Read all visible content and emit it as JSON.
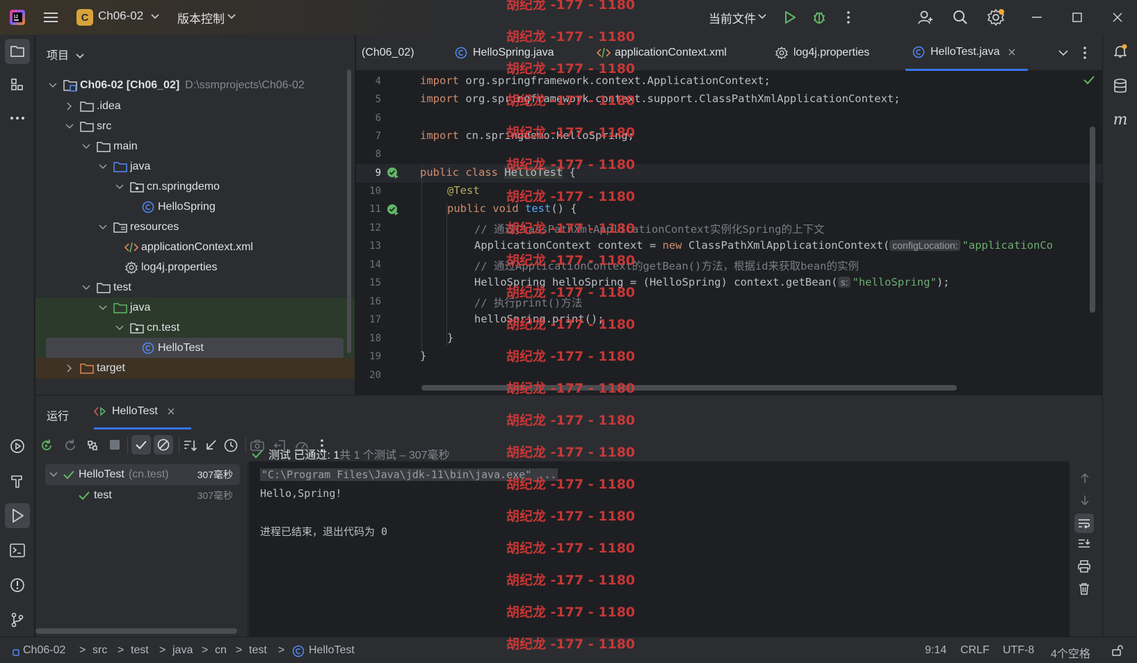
{
  "titlebar": {
    "project_badge": "C",
    "project_name": "Ch06-02",
    "vcs_menu": "版本控制",
    "run_config": "当前文件"
  },
  "project_panel": {
    "header": "项目",
    "tree": [
      {
        "label": "Ch06-02 [Ch06_02]",
        "path": "D:\\ssmprojects\\Ch06-02"
      },
      {
        "label": ".idea"
      },
      {
        "label": "src"
      },
      {
        "label": "main"
      },
      {
        "label": "java"
      },
      {
        "label": "cn.springdemo"
      },
      {
        "label": "HelloSpring"
      },
      {
        "label": "resources"
      },
      {
        "label": "applicationContext.xml"
      },
      {
        "label": "log4j.properties"
      },
      {
        "label": "test"
      },
      {
        "label": "java"
      },
      {
        "label": "cn.test"
      },
      {
        "label": "HelloTest"
      },
      {
        "label": "target"
      }
    ]
  },
  "tabs": [
    {
      "label": "(Ch06_02)"
    },
    {
      "label": "HelloSpring.java"
    },
    {
      "label": "applicationContext.xml"
    },
    {
      "label": "log4j.properties"
    },
    {
      "label": "HelloTest.java"
    }
  ],
  "editor": {
    "line_numbers": [
      "4",
      "5",
      "6",
      "7",
      "8",
      "9",
      "10",
      "11",
      "12",
      "13",
      "14",
      "15",
      "16",
      "17",
      "18",
      "19",
      "20"
    ],
    "code": {
      "l4_kw": "import",
      "l4_rest": " org.springframework.context.ApplicationContext;",
      "l5_kw": "import",
      "l5_rest": " org.springframework.context.support.ClassPathXmlApplicationContext;",
      "l7_kw": "import",
      "l7_rest": " cn.springdemo.HelloSpring;",
      "l9_kw": "public class",
      "l9_name": "HelloTest",
      "l9_rest": " {",
      "l10_ann": "@Test",
      "l11_kw": "public void",
      "l11_fn": "test",
      "l11_rest": "() {",
      "l12_cm": "// 通过ClassPathXmlApplicationContext实例化Spring的上下文",
      "l13_a": "ApplicationContext context = ",
      "l13_kw": "new",
      "l13_b": " ClassPathXmlApplicationContext(",
      "l13_hint": "configLocation:",
      "l13_str": "\"applicationCo",
      "l14_cm": "// 通过ApplicationContext的getBean()方法，根据id来获取bean的实例",
      "l15_a": "HelloSpring helloSpring = (HelloSpring) context.getBean(",
      "l15_hint": "s:",
      "l15_str": "\"helloSpring\"",
      "l15_b": ");",
      "l16_cm": "// 执行print()方法",
      "l17": "helloSpring.print();",
      "l18": "}",
      "l19": "}"
    }
  },
  "run_panel": {
    "tab_run": "运行",
    "tab_config": "HelloTest",
    "tests": [
      {
        "name": "HelloTest",
        "pkg": "(cn.test)",
        "time": "307毫秒"
      },
      {
        "name": "test",
        "time": "307毫秒"
      }
    ],
    "summary_passed": "测试 已通过: 1",
    "summary_total": "共 1 个测试 – 307毫秒",
    "console": [
      "\"C:\\Program Files\\Java\\jdk-11\\bin\\java.exe\" ...",
      "Hello,Spring!",
      "",
      "进程已结束，退出代码为 0"
    ]
  },
  "statusbar": {
    "breadcrumbs": [
      "Ch06-02",
      "src",
      "test",
      "java",
      "cn",
      "test",
      "HelloTest"
    ],
    "position": "9:14",
    "line_sep": "CRLF",
    "encoding": "UTF-8",
    "indent": "4个空格"
  },
  "watermark": "胡纪龙 -177 - 1180",
  "colors": {
    "accent": "#3574f0",
    "pass_green": "#5fb865",
    "watermark_red": "#d83a3a"
  }
}
